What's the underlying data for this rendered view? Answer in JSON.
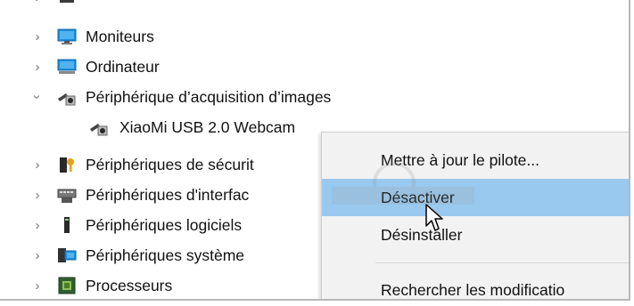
{
  "tree": {
    "items": [
      {
        "label": "",
        "expander": "collapsed",
        "icon": "printer-icon"
      },
      {
        "label": "Moniteurs",
        "expander": "collapsed",
        "icon": "monitor-icon"
      },
      {
        "label": "Ordinateur",
        "expander": "collapsed",
        "icon": "computer-icon"
      },
      {
        "label": "Périphérique d’acquisition d’images",
        "expander": "expanded",
        "icon": "webcam-icon"
      },
      {
        "label": "XiaoMi USB 2.0 Webcam",
        "expander": "none",
        "icon": "webcam-icon"
      },
      {
        "label": "Périphériques de sécurit",
        "expander": "collapsed",
        "icon": "security-device-icon"
      },
      {
        "label": "Périphériques d'interfac",
        "expander": "collapsed",
        "icon": "hid-device-icon"
      },
      {
        "label": "Périphériques logiciels",
        "expander": "collapsed",
        "icon": "software-device-icon"
      },
      {
        "label": "Périphériques système",
        "expander": "collapsed",
        "icon": "system-device-icon"
      },
      {
        "label": "Processeurs",
        "expander": "collapsed",
        "icon": "processor-icon"
      }
    ]
  },
  "context_menu": {
    "items": [
      {
        "label": "Mettre à jour le pilote...",
        "highlighted": false
      },
      {
        "label": "Désactiver",
        "highlighted": true
      },
      {
        "label": "Désinstaller",
        "highlighted": false
      },
      {
        "label": "Rechercher les modificatio",
        "highlighted": false
      }
    ]
  },
  "colors": {
    "highlight": "#99c9ef",
    "menu_background": "#f2f2f2",
    "text": "#111111"
  }
}
